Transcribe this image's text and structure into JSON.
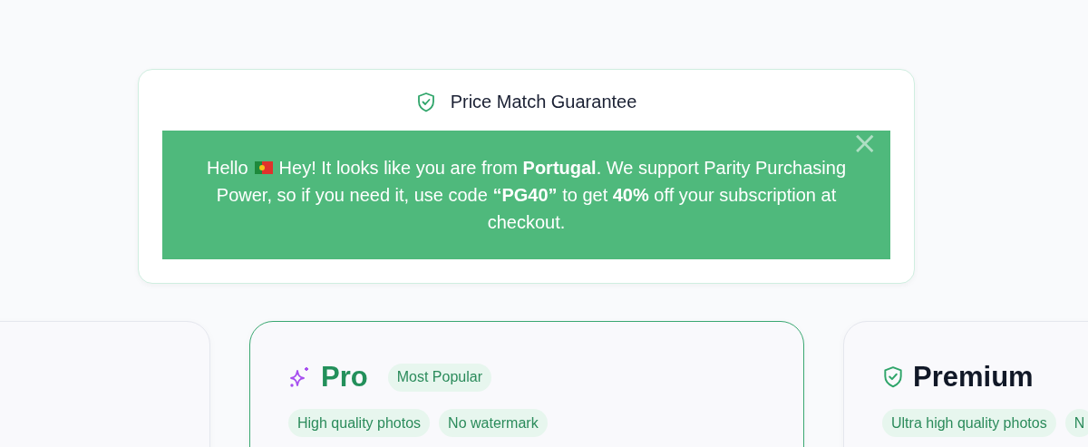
{
  "guarantee": {
    "title": "Price Match Guarantee",
    "greeting": "Hello",
    "message_lines": [
      "Hey! It looks like you are from **Portugal**. We support Parity Purchasing",
      "Power, so if you need it, use code **“PG40”** to get **40%** off your subscription at checkout."
    ],
    "close": "×"
  },
  "plans": [
    {
      "kind": "blank",
      "selected": false
    },
    {
      "kind": "sparkle",
      "name": "Pro",
      "badge": "Most Popular",
      "selected": true,
      "features": [
        "High quality photos",
        "No watermark"
      ]
    },
    {
      "kind": "shield",
      "name": "Premium",
      "selected": false,
      "features": [
        "Ultra high quality photos",
        "N"
      ]
    }
  ]
}
